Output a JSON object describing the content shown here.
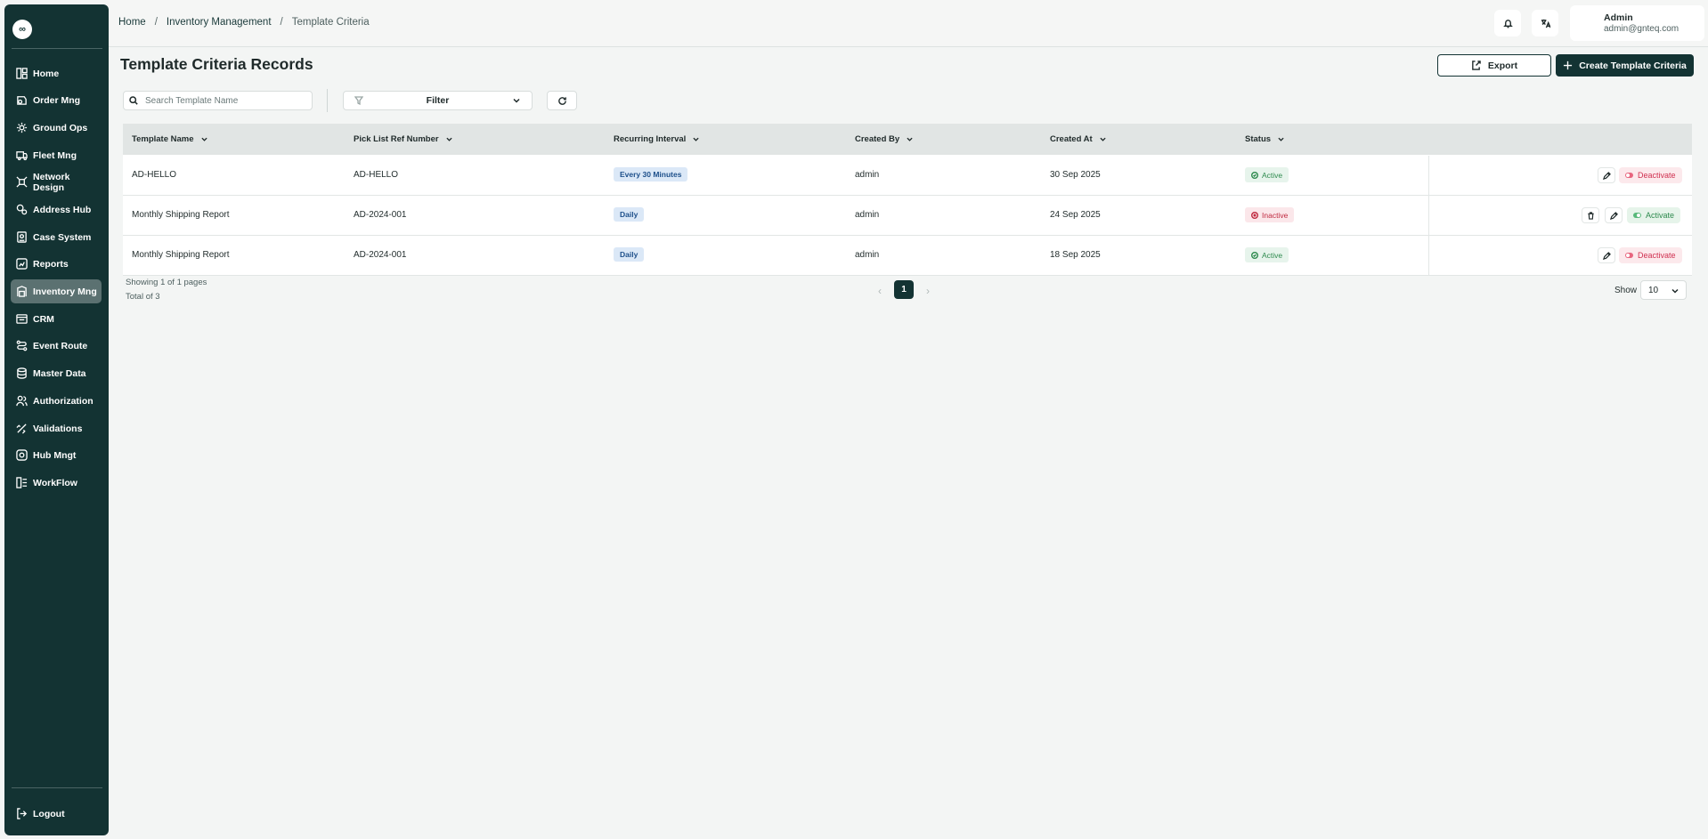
{
  "logo": "∞",
  "sidebar": {
    "items": [
      {
        "label": "Home",
        "icon": "home-icon"
      },
      {
        "label": "Order Mng",
        "icon": "order-icon"
      },
      {
        "label": "Ground Ops",
        "icon": "ground-ops-icon"
      },
      {
        "label": "Fleet Mng",
        "icon": "truck-icon"
      },
      {
        "label": "Network Design",
        "icon": "network-icon"
      },
      {
        "label": "Address Hub",
        "icon": "address-icon"
      },
      {
        "label": "Case System",
        "icon": "case-icon"
      },
      {
        "label": "Reports",
        "icon": "reports-icon"
      },
      {
        "label": "Inventory Mng",
        "icon": "inventory-icon",
        "active": true
      },
      {
        "label": "CRM",
        "icon": "crm-icon"
      },
      {
        "label": "Event Route",
        "icon": "route-icon"
      },
      {
        "label": "Master Data",
        "icon": "database-icon"
      },
      {
        "label": "Authorization",
        "icon": "users-icon"
      },
      {
        "label": "Validations",
        "icon": "validations-icon"
      },
      {
        "label": "Hub Mngt",
        "icon": "hub-icon"
      },
      {
        "label": "WorkFlow",
        "icon": "workflow-icon"
      }
    ],
    "logout": "Logout"
  },
  "header": {
    "breadcrumb": [
      "Home",
      "Inventory Management",
      "Template Criteria"
    ],
    "separator": "/",
    "user_name": "Admin",
    "user_email": "admin@gnteq.com"
  },
  "main": {
    "title": "Template Criteria Records",
    "export_label": "Export",
    "create_label": "Create Template Criteria",
    "search_placeholder": "Search Template Name",
    "filter_label": "Filter"
  },
  "table": {
    "columns": [
      "Template Name",
      "Pick List Ref Number",
      "Recurring Interval",
      "Created By",
      "Created At",
      "Status"
    ],
    "rows": [
      {
        "name": "AD-HELLO",
        "ref": "AD-HELLO",
        "interval": "Every 30 Minutes",
        "created_by": "admin",
        "created_at": "30 Sep 2025",
        "status": "Active",
        "action": "Deactivate"
      },
      {
        "name": "Monthly Shipping Report",
        "ref": "AD-2024-001",
        "interval": "Daily",
        "created_by": "admin",
        "created_at": "24 Sep 2025",
        "status": "Inactive",
        "action": "Activate"
      },
      {
        "name": "Monthly Shipping Report",
        "ref": "AD-2024-001",
        "interval": "Daily",
        "created_by": "admin",
        "created_at": "18 Sep 2025",
        "status": "Active",
        "action": "Deactivate"
      }
    ]
  },
  "pagination": {
    "showing": "Showing 1 of 1 pages",
    "total": "Total of 3",
    "current_page": "1",
    "prev": "‹",
    "next": "›",
    "show_label": "Show",
    "page_size": "10"
  },
  "colors": {
    "sidebar_bg": "#133333",
    "primary": "#133333",
    "active_green": "#2e8a4e",
    "inactive_red": "#c02a40",
    "chip_blue": "#1d4f8a"
  }
}
